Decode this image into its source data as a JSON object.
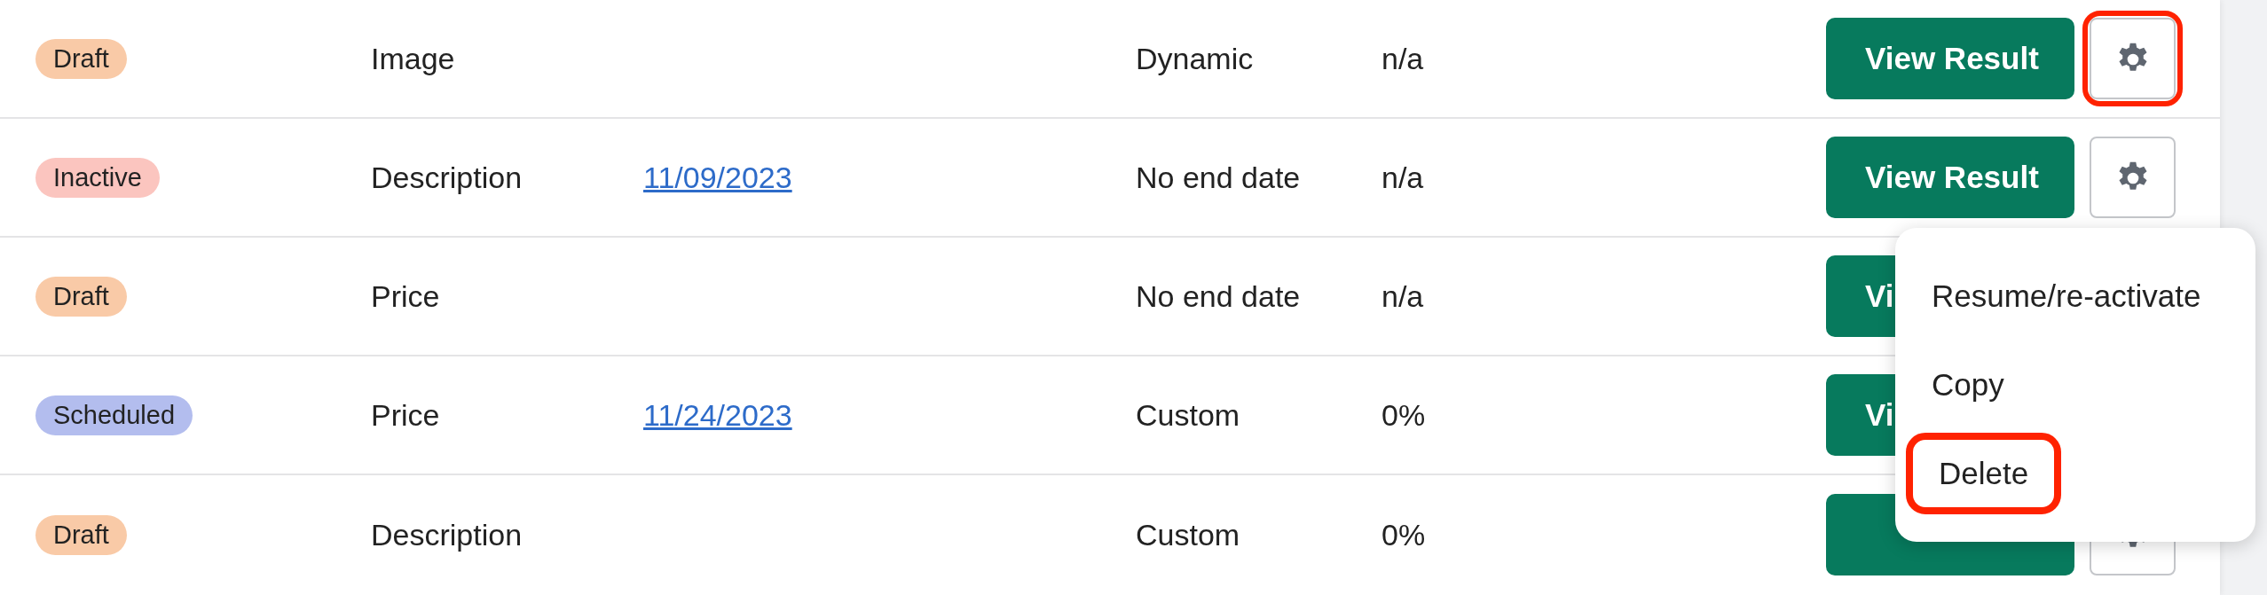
{
  "rows": [
    {
      "status": {
        "label": "Draft",
        "color": "#f9caa7"
      },
      "type": "Image",
      "date": null,
      "duration": "Dynamic",
      "value": "n/a",
      "button": "View Result",
      "settings_button": true,
      "settings_highlighted": true
    },
    {
      "status": {
        "label": "Inactive",
        "color": "#fbc5bf"
      },
      "type": "Description",
      "date": "11/09/2023",
      "duration": "No end date",
      "value": "n/a",
      "button": "View Result",
      "settings_button": true,
      "settings_highlighted": false
    },
    {
      "status": {
        "label": "Draft",
        "color": "#f9caa7"
      },
      "type": "Price",
      "date": null,
      "duration": "No end date",
      "value": "n/a",
      "button": "Vi",
      "settings_button": false
    },
    {
      "status": {
        "label": "Scheduled",
        "color": "#b3bdee"
      },
      "type": "Price",
      "date": "11/24/2023",
      "duration": "Custom",
      "value": "0%",
      "button": "Vi",
      "settings_button": false
    },
    {
      "status": {
        "label": "Draft",
        "color": "#f9caa7"
      },
      "type": "Description",
      "date": null,
      "duration": "Custom",
      "value": "0%",
      "settings_button": true
    }
  ],
  "menu": {
    "items": [
      {
        "label": "Resume/re-activate",
        "highlighted": false
      },
      {
        "label": "Copy",
        "highlighted": false
      },
      {
        "label": "Delete",
        "highlighted": true
      }
    ]
  }
}
